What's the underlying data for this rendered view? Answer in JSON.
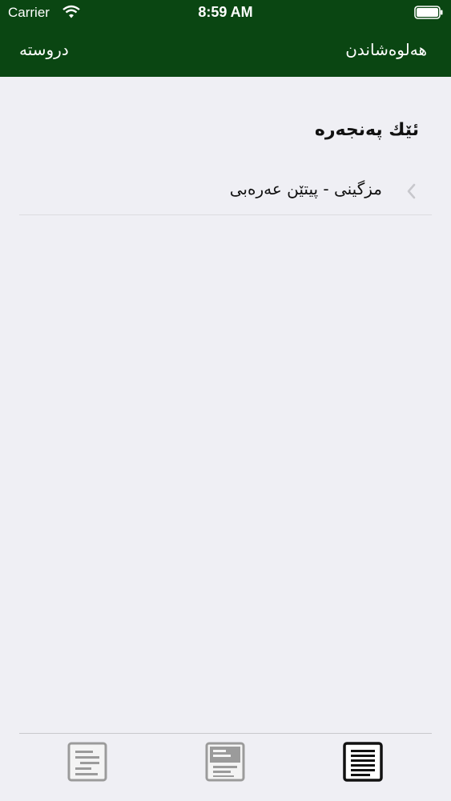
{
  "status_bar": {
    "carrier": "Carrier",
    "time": "8:59 AM"
  },
  "nav": {
    "left_label": "دروسته",
    "right_label": "هەلوەشاندن",
    "background_color": "#0a4612"
  },
  "section": {
    "header": "ئێك پەنجەرە"
  },
  "list": {
    "items": [
      {
        "label": "مزگینی - پیتێن عەرەبی"
      }
    ]
  },
  "tab_bar": {
    "tabs": [
      {
        "icon": "text-lines-icon"
      },
      {
        "icon": "document-block-icon"
      },
      {
        "icon": "page-lines-icon",
        "selected": true
      }
    ]
  }
}
